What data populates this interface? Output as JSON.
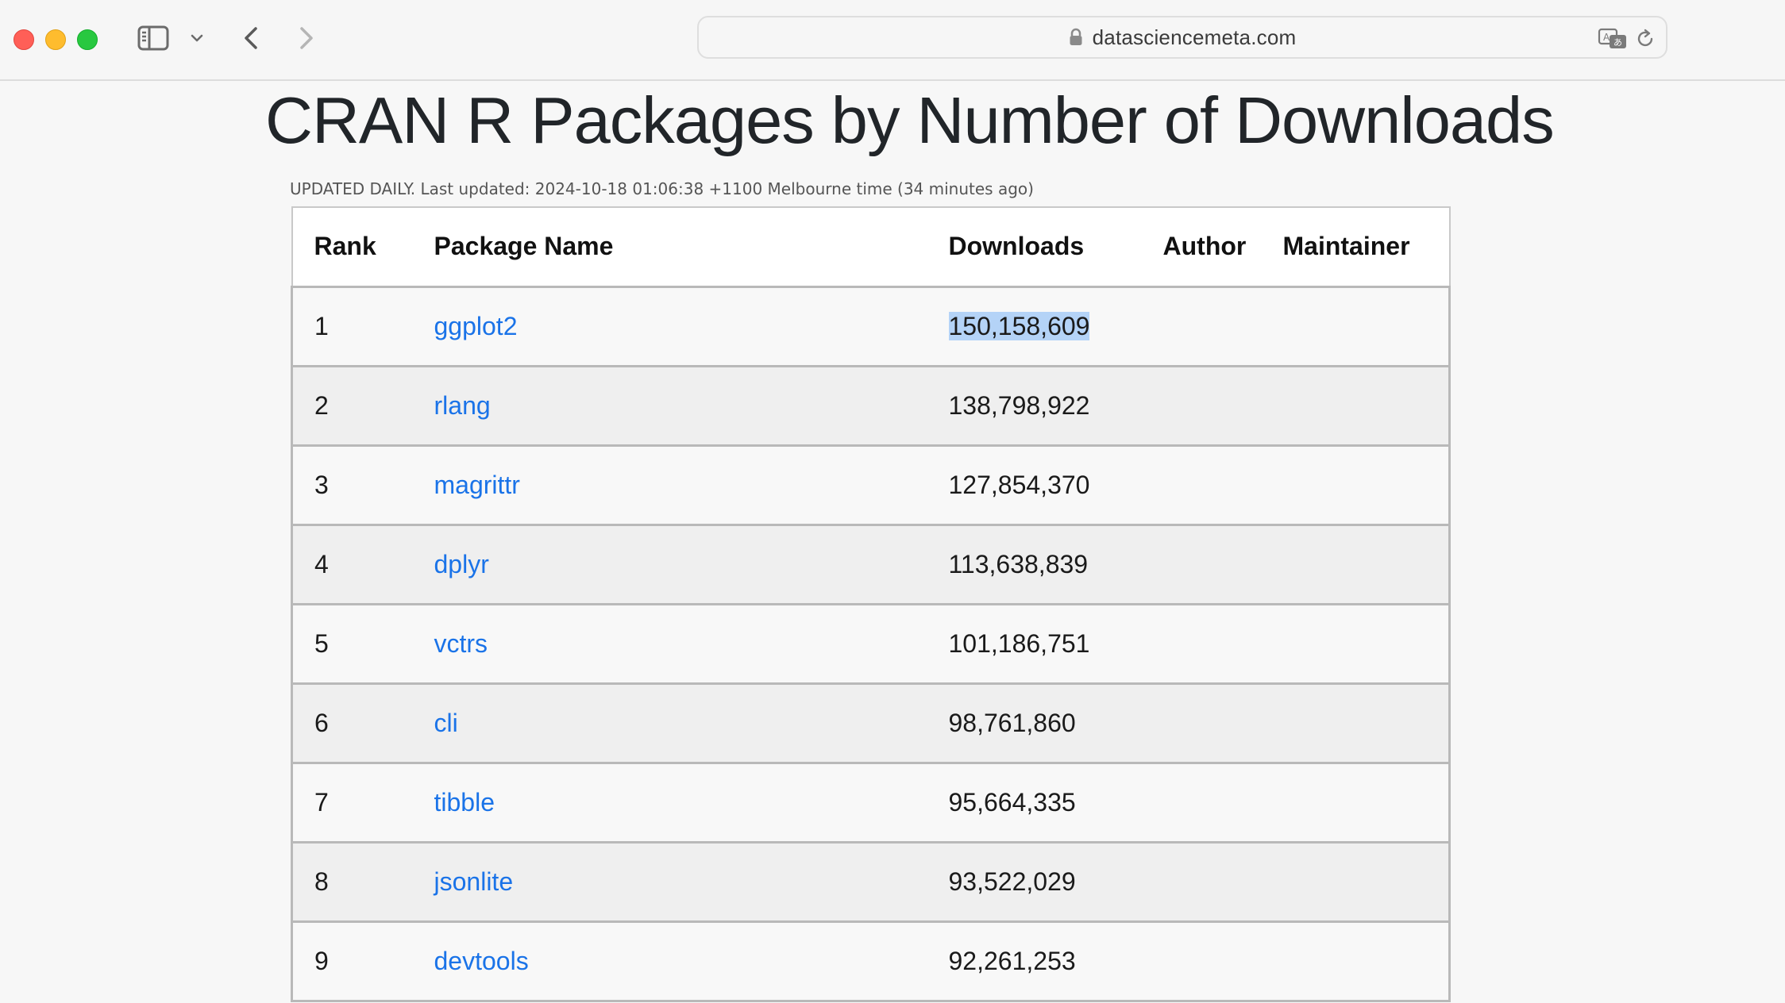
{
  "browser": {
    "url": "datasciencemeta.com"
  },
  "page": {
    "title": "CRAN R Packages by Number of Downloads",
    "updated_note": "UPDATED DAILY. Last updated: 2024-10-18 01:06:38 +1100 Melbourne time (34 minutes ago)"
  },
  "table": {
    "headers": {
      "rank": "Rank",
      "name": "Package Name",
      "downloads": "Downloads",
      "author": "Author",
      "maintainer": "Maintainer"
    },
    "rows": [
      {
        "rank": "1",
        "name": "ggplot2",
        "downloads": "150,158,609",
        "author": "",
        "maintainer": ""
      },
      {
        "rank": "2",
        "name": "rlang",
        "downloads": "138,798,922",
        "author": "",
        "maintainer": ""
      },
      {
        "rank": "3",
        "name": "magrittr",
        "downloads": "127,854,370",
        "author": "",
        "maintainer": ""
      },
      {
        "rank": "4",
        "name": "dplyr",
        "downloads": "113,638,839",
        "author": "",
        "maintainer": ""
      },
      {
        "rank": "5",
        "name": "vctrs",
        "downloads": "101,186,751",
        "author": "",
        "maintainer": ""
      },
      {
        "rank": "6",
        "name": "cli",
        "downloads": "98,761,860",
        "author": "",
        "maintainer": ""
      },
      {
        "rank": "7",
        "name": "tibble",
        "downloads": "95,664,335",
        "author": "",
        "maintainer": ""
      },
      {
        "rank": "8",
        "name": "jsonlite",
        "downloads": "93,522,029",
        "author": "",
        "maintainer": ""
      },
      {
        "rank": "9",
        "name": "devtools",
        "downloads": "92,261,253",
        "author": "",
        "maintainer": ""
      }
    ]
  },
  "colors": {
    "link": "#1a73e8",
    "selection": "#b4d3f7"
  },
  "icons": [
    "sidebar-icon",
    "chevron-down-icon",
    "back-arrow-icon",
    "forward-arrow-icon",
    "lock-icon",
    "translate-icon",
    "reload-icon"
  ]
}
